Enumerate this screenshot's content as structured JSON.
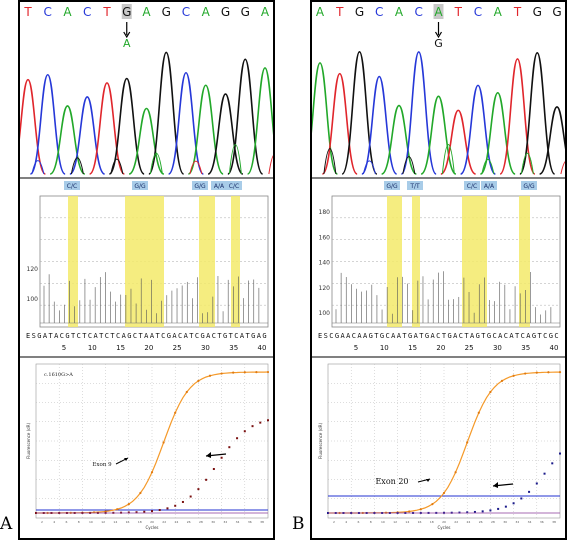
{
  "panels": [
    {
      "id": "A",
      "letter": "A",
      "chromatogram": {
        "bases": [
          "T",
          "C",
          "A",
          "C",
          "T",
          "G",
          "A",
          "G",
          "C",
          "A",
          "G",
          "G",
          "A"
        ],
        "highlight_index": 5,
        "variant_base": "A",
        "colors": {
          "A": "#22a82a",
          "C": "#2638d8",
          "G": "#111111",
          "T": "#e0262c"
        }
      },
      "pyrogram": {
        "genotype_tags": [
          "C/C",
          "G/G",
          "G/G",
          "A/A",
          "C/C"
        ],
        "y_ticks": [
          "100",
          "120"
        ],
        "sequence": "ESGATACGTCTCATCTCAGCTAATCGACATCGACTGTCATGAG",
        "x_ticks": [
          "5",
          "10",
          "15",
          "20",
          "25",
          "30",
          "35",
          "40"
        ]
      },
      "hrm": {
        "label": "c.1610G>A",
        "curve_label": "Exon 9",
        "y_axis_title": "Fluorescence (dR)",
        "x_axis_title": "Cycles"
      }
    },
    {
      "id": "B",
      "letter": "B",
      "chromatogram": {
        "bases": [
          "A",
          "T",
          "G",
          "C",
          "A",
          "C",
          "A",
          "T",
          "C",
          "A",
          "T",
          "G",
          "G"
        ],
        "highlight_index": 6,
        "variant_base": "G",
        "colors": {
          "A": "#22a82a",
          "C": "#2638d8",
          "G": "#111111",
          "T": "#e0262c"
        }
      },
      "pyrogram": {
        "genotype_tags": [
          "G/G",
          "T/T",
          "C/C",
          "A/A",
          "G/G"
        ],
        "y_ticks": [
          "180",
          "160",
          "140",
          "120",
          "100"
        ],
        "sequence": "ESCGAACAAGTGCAATGATGACTGACTAGTGCACATCAGTCGC",
        "x_ticks": [
          "5",
          "10",
          "15",
          "20",
          "25",
          "30",
          "35",
          "40"
        ]
      },
      "hrm": {
        "label": "",
        "curve_label": "Exon 20",
        "y_axis_title": "Fluorescence (dR)",
        "x_axis_title": "Cycles"
      }
    }
  ]
}
